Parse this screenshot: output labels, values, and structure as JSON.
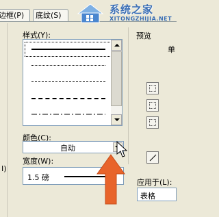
{
  "tabs": [
    {
      "label": "边框(P)"
    },
    {
      "label": "底纹(S)"
    }
  ],
  "watermark": {
    "title": "系统之家",
    "url": "XITONGZHIJIA.NET"
  },
  "left_strip": {
    "char": "I)"
  },
  "style": {
    "label": "样式(Y):",
    "items": [
      "solid",
      "dotted",
      "dashed-fine",
      "dashed",
      "dash-dot"
    ]
  },
  "color": {
    "label": "颜色(C):",
    "value": "自动"
  },
  "width": {
    "label": "宽度(W):",
    "value": "1.5 磅"
  },
  "preview": {
    "label": "预览",
    "single": "单"
  },
  "apply_to": {
    "label": "应用于(L):",
    "value": "表格"
  },
  "colors": {
    "arrow": "#e8642b",
    "list_border": "#7f9db9",
    "watermark": "#3b6fb5"
  }
}
